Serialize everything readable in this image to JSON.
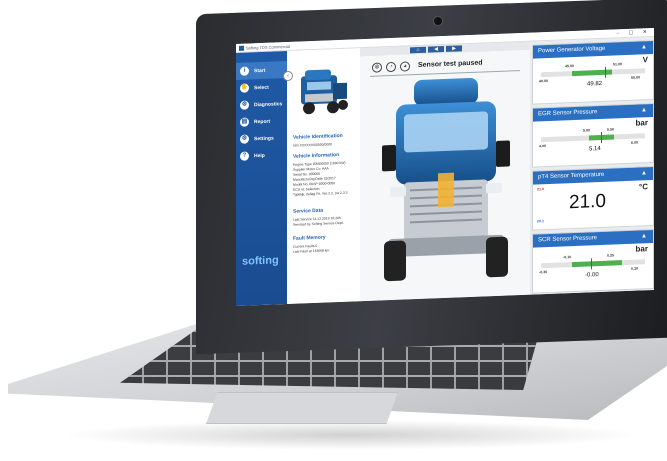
{
  "window_title": "Softing TDS Commercial",
  "window_buttons": "–  ▢  ✕",
  "toolbar": {
    "home": "⌂",
    "prev": "◀",
    "next": "▶"
  },
  "sidebar": {
    "items": [
      {
        "label": "Start",
        "icon": "i"
      },
      {
        "label": "Select",
        "icon": "✋"
      },
      {
        "label": "Diagnostics",
        "icon": "⚙"
      },
      {
        "label": "Report",
        "icon": "▤"
      },
      {
        "label": "Settings",
        "icon": "⚙"
      },
      {
        "label": "Help",
        "icon": "?"
      }
    ],
    "brand": "softing"
  },
  "info": {
    "vehicle_identification": {
      "title": "Vehicle Identification",
      "vin": "VIN XXXXXX/00000/0000"
    },
    "vehicle_information": {
      "title": "Vehicle Information",
      "lines": [
        "Engine Type ISMO0000 (1000 kW)",
        "Supplier Motor Co. AAA",
        "Serial No. 000000",
        "Manufacturing Date 10/2017",
        "Model No. 00AP-0000-0000",
        "ECU id: Selection",
        "Tijdelijk, defiag Fit, Yes 2.2, sw 2.3.3"
      ]
    },
    "service_data": {
      "title": "Service Data",
      "lines": [
        "Last Service 14.12.2019 16:20h",
        "Serviced by Softing Service Dept."
      ]
    },
    "fault_memory": {
      "title": "Fault Memory",
      "lines": [
        "Current Faults 0",
        "Last Fault at 133668 km"
      ]
    }
  },
  "main": {
    "status_text": "Sensor test paused"
  },
  "panels": [
    {
      "title": "Power Generator Voltage",
      "unit": "V",
      "min": "40.00",
      "max": "55.00",
      "lo": "45.00",
      "hi": "51.00",
      "value": "49.82",
      "fraction": 0.62
    },
    {
      "title": "EGR Sensor Pressure",
      "unit": "bar",
      "min": "4.00",
      "max": "6.00",
      "lo": "5.00",
      "hi": "5.50",
      "value": "5.14",
      "fraction": 0.58
    },
    {
      "title": "pT4 Sensor Temperature",
      "unit": "°C",
      "upper_limit": "21.0",
      "lower_limit": "20.1",
      "value": "21.0"
    },
    {
      "title": "SCR Sensor Pressure",
      "unit": "bar",
      "min": "-0.30",
      "max": "0.30",
      "lo": "-0.10",
      "hi": "0.25",
      "value": "-0.00",
      "fraction": 0.48
    }
  ],
  "colors": {
    "accent": "#2b6fc2",
    "sidebar": "#1f5aa6",
    "gauge_ok": "#4cb04c",
    "limit": "#d22222"
  }
}
